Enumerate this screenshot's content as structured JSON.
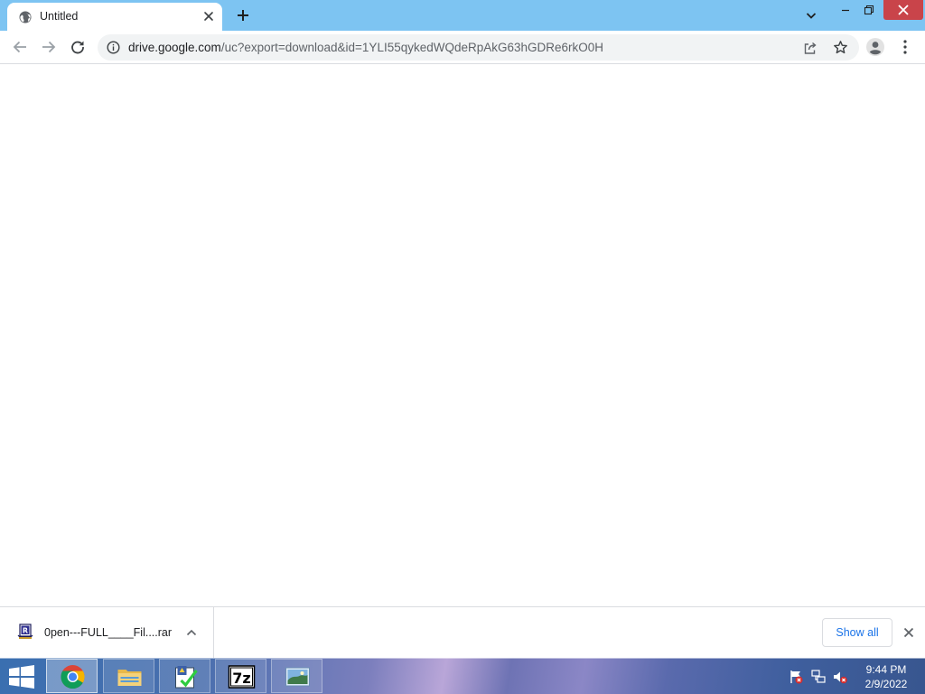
{
  "browser": {
    "tab": {
      "title": "Untitled",
      "favicon": "globe-icon"
    },
    "address": {
      "host": "drive.google.com",
      "path": "/uc?export=download&id=1YLI55qykedWQdeRpAkG63hGDRe6rkO0H"
    },
    "colors": {
      "tabstrip": "#7dc4f2",
      "close_button": "#c9444a",
      "accent": "#1a73e8"
    }
  },
  "downloads": {
    "file_name": "0pen---FULL____Fil....rar",
    "file_icon": "winrar-archive-icon",
    "show_all_label": "Show all"
  },
  "taskbar": {
    "apps": [
      {
        "name": "chrome-icon",
        "active": true
      },
      {
        "name": "file-explorer-icon",
        "active": false
      },
      {
        "name": "checklist-app-icon",
        "active": false
      },
      {
        "name": "7zip-icon",
        "active": false,
        "label": "7z"
      },
      {
        "name": "photo-viewer-icon",
        "active": false
      }
    ],
    "tray": [
      "action-center-flag-icon",
      "network-icon",
      "volume-muted-icon"
    ],
    "clock": {
      "time": "9:44 PM",
      "date": "2/9/2022"
    }
  }
}
